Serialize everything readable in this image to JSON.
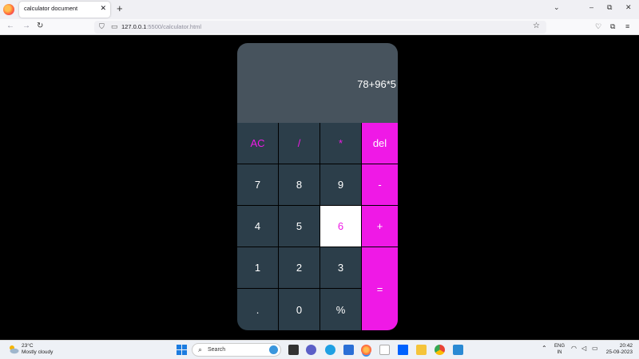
{
  "browser": {
    "tab_title": "calculator document",
    "tab_close": "✕",
    "new_tab": "+",
    "url_host": "127.0.0.1",
    "url_rest": ":5500/calculator.html",
    "window_controls": {
      "list_tabs": "⌄",
      "minimize": "–",
      "restore": "⧉",
      "close": "✕"
    },
    "nav": {
      "back": "←",
      "forward": "→",
      "reload": "↻",
      "star": "☆",
      "pocket": "♡",
      "extensions": "⧉",
      "menu": "≡"
    }
  },
  "calculator": {
    "display": "78+96*5",
    "keys": {
      "ac": "AC",
      "divide": "/",
      "multiply": "*",
      "del": "del",
      "seven": "7",
      "eight": "8",
      "nine": "9",
      "minus": "-",
      "four": "4",
      "five": "5",
      "six": "6",
      "plus": "+",
      "one": "1",
      "two": "2",
      "three": "3",
      "equals": "=",
      "dot": ".",
      "zero": "0",
      "percent": "%"
    },
    "accent_color": "#ef19e6",
    "key_color": "#2c3e4a",
    "display_color": "#47535d"
  },
  "taskbar": {
    "weather_temp": "23°C",
    "weather_desc": "Mostly cloudy",
    "search_label": "Search",
    "lang_top": "ENG",
    "lang_bottom": "IN",
    "time": "20:42",
    "date": "25-09-2023",
    "apps": [
      "task-view-icon",
      "chat-icon",
      "edge-icon",
      "store-icon",
      "firefox-icon",
      "amazon-icon",
      "dropbox-icon",
      "file-explorer-icon",
      "chrome-icon",
      "vscode-icon"
    ]
  }
}
